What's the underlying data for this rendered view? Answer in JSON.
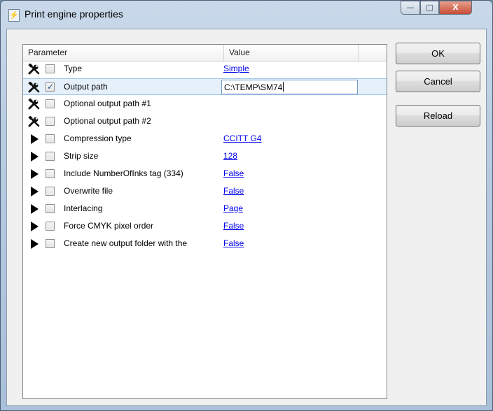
{
  "window": {
    "title": "Print engine properties",
    "minimize_glyph": "—",
    "maximize_glyph": "□",
    "close_glyph": "X"
  },
  "grid": {
    "columns": [
      "Parameter",
      "Value"
    ],
    "rows": [
      {
        "icon": "tools-icon",
        "checked": false,
        "name": "Type",
        "value": "Simple",
        "link": true
      },
      {
        "icon": "tools-icon",
        "checked": true,
        "name": "Output path",
        "value": "C:\\TEMP\\SM74",
        "editing": true
      },
      {
        "icon": "tools-icon",
        "checked": false,
        "name": "Optional output path #1",
        "value": ""
      },
      {
        "icon": "tools-icon",
        "checked": false,
        "name": "Optional output path #2",
        "value": ""
      },
      {
        "icon": "play-icon",
        "checked": false,
        "name": "Compression type",
        "value": "CCITT G4",
        "link": true
      },
      {
        "icon": "play-icon",
        "checked": false,
        "name": "Strip size",
        "value": "128",
        "link": true
      },
      {
        "icon": "play-icon",
        "checked": false,
        "name": "Include NumberOfInks tag (334)",
        "value": "False",
        "link": true
      },
      {
        "icon": "play-icon",
        "checked": false,
        "name": "Overwrite file",
        "value": "False",
        "link": true
      },
      {
        "icon": "play-icon",
        "checked": false,
        "name": "Interlacing",
        "value": "Page",
        "link": true
      },
      {
        "icon": "play-icon",
        "checked": false,
        "name": "Force CMYK pixel order",
        "value": "False",
        "link": true
      },
      {
        "icon": "play-icon",
        "checked": false,
        "name": "Create new output folder with the",
        "value": "False",
        "link": true
      }
    ]
  },
  "buttons": {
    "ok": "OK",
    "cancel": "Cancel",
    "reload": "Reload"
  }
}
